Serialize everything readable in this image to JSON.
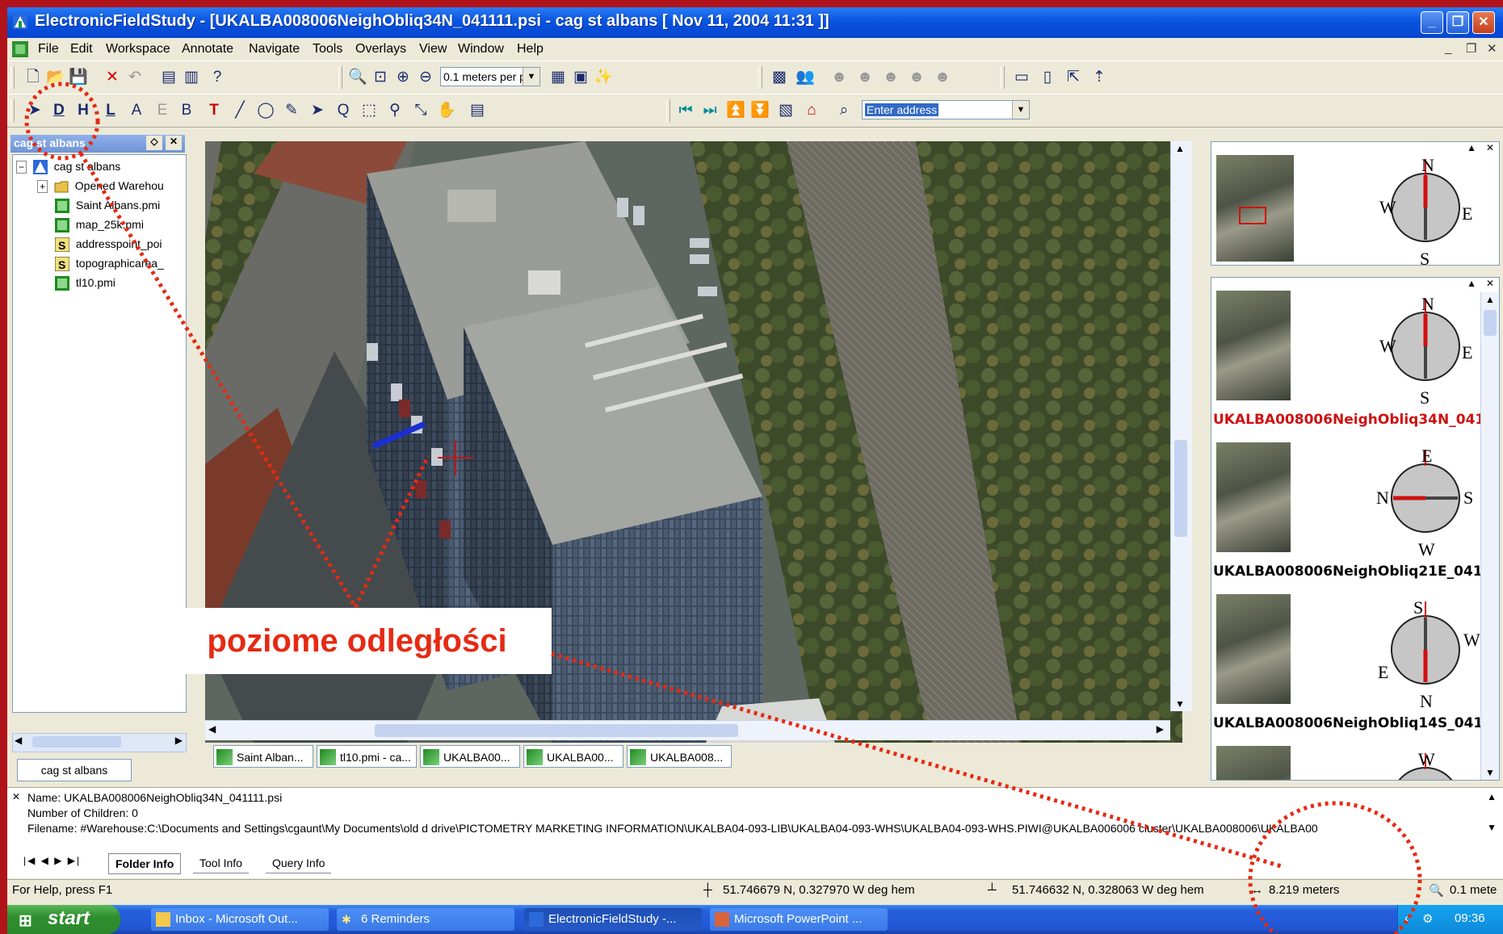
{
  "window": {
    "title": "ElectronicFieldStudy - [UKALBA008006NeighObliq34N_041111.psi - cag st albans [ Nov 11, 2004 11:31 ]]"
  },
  "menubar": {
    "items": [
      "File",
      "Edit",
      "Workspace",
      "Annotate",
      "Navigate",
      "Tools",
      "Overlays",
      "View",
      "Window",
      "Help"
    ]
  },
  "toolbar": {
    "scale_value": "0.1 meters per p",
    "address_placeholder": "Enter address"
  },
  "left_panel": {
    "header": "cag st albans",
    "tree": [
      {
        "label": "cag st albans",
        "icon": "workspace-icon"
      },
      {
        "label": "Opened Warehou",
        "icon": "folder-icon"
      },
      {
        "label": "Saint Albans.pmi",
        "icon": "map-icon"
      },
      {
        "label": "map_25k.pmi",
        "icon": "map-icon"
      },
      {
        "label": "addresspoint_poi",
        "icon": "script-icon"
      },
      {
        "label": "topographicarea_",
        "icon": "script-icon"
      },
      {
        "label": "tl10.pmi",
        "icon": "map-icon"
      }
    ],
    "bottom_tab": "cag st albans"
  },
  "doc_tabs": [
    "Saint Alban...",
    "tl10.pmi - ca...",
    "UKALBA00...",
    "UKALBA00...",
    "UKALBA008..."
  ],
  "right_panel": {
    "overview": {
      "compass": {
        "top": "N",
        "left": "W",
        "right": "E",
        "bottom": "S"
      }
    },
    "images": [
      {
        "label": "UKALBA008006NeighObliq34N_041",
        "selected": true,
        "compass": {
          "top": "N",
          "left": "W",
          "right": "E",
          "bottom": "S"
        }
      },
      {
        "label": "UKALBA008006NeighObliq21E_041",
        "selected": false,
        "compass": {
          "top": "E",
          "left": "N",
          "right": "S",
          "bottom": "W"
        }
      },
      {
        "label": "UKALBA008006NeighObliq14S_041",
        "selected": false,
        "compass": {
          "top": "S",
          "left": "E",
          "right": "W",
          "bottom": "N"
        }
      },
      {
        "label": "",
        "selected": false,
        "compass": {
          "top": "W",
          "left": "",
          "right": "",
          "bottom": ""
        }
      }
    ]
  },
  "info_panel": {
    "name": "Name: UKALBA008006NeighObliq34N_041111.psi",
    "children": "Number of Children: 0",
    "filename": "Filename: #Warehouse:C:\\Documents and Settings\\cgaunt\\My Documents\\old d drive\\PICTOMETRY MARKETING INFORMATION\\UKALBA04-093-LIB\\UKALBA04-093-WHS\\UKALBA04-093-WHS.PIWI@UKALBA006006 cluster\\UKALBA008006\\UKALBA00",
    "tabs": [
      "Folder Info",
      "Tool Info",
      "Query Info"
    ]
  },
  "status_bar": {
    "help": "For Help, press F1",
    "coord1": "51.746679 N, 0.327970 W  deg hem",
    "coord2": "51.746632 N, 0.328063 W  deg hem",
    "distance": "8.219 meters",
    "zoom": "0.1 mete"
  },
  "taskbar": {
    "start": "start",
    "tasks": [
      "Inbox - Microsoft Out...",
      "6 Reminders",
      "ElectronicFieldStudy -...",
      "Microsoft PowerPoint ..."
    ],
    "clock": "09:36"
  },
  "annotation": {
    "text": "poziome odległości"
  },
  "colors": {
    "background_red": "#b1131b",
    "annotation_red": "#e52a13",
    "selected_label": "#cc1111",
    "measure_line": "#1a2fd1"
  }
}
